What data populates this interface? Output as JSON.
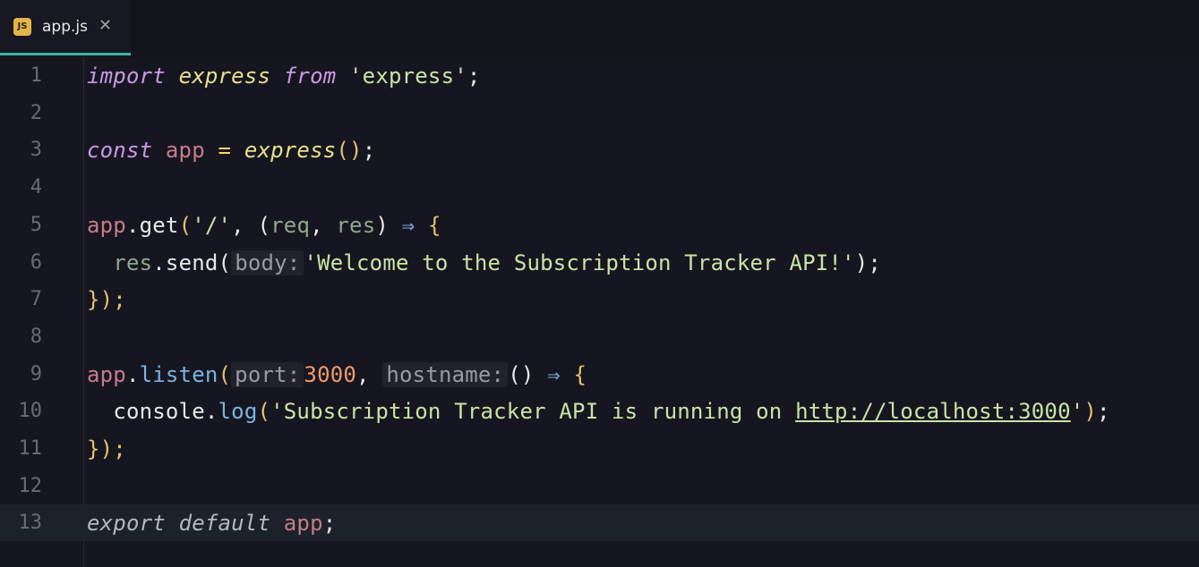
{
  "tab": {
    "icon": "JS",
    "label": "app.js",
    "close": "✕"
  },
  "lines": [
    {
      "n": "1"
    },
    {
      "n": "2"
    },
    {
      "n": "3"
    },
    {
      "n": "4"
    },
    {
      "n": "5"
    },
    {
      "n": "6"
    },
    {
      "n": "7"
    },
    {
      "n": "8"
    },
    {
      "n": "9"
    },
    {
      "n": "10"
    },
    {
      "n": "11"
    },
    {
      "n": "12"
    },
    {
      "n": "13"
    }
  ],
  "code": {
    "l1": {
      "kw_import": "import",
      "id_express": "express",
      "kw_from": "from",
      "str": "'express'",
      "semi": ";"
    },
    "l3": {
      "kw_const": "const",
      "var_app": "app",
      "eq": "=",
      "fn_express": "express",
      "paren": "()",
      "semi": ";"
    },
    "l5": {
      "var_app": "app",
      "dot": ".",
      "method": "get",
      "open": "(",
      "str": "'/'",
      "comma": ",",
      "open2": "(",
      "req": "req",
      "comma2": ",",
      "res": "res",
      "close2": ")",
      "arrow": "⇒",
      "brace": "{"
    },
    "l6": {
      "res": "res",
      "dot": ".",
      "method": "send",
      "open": "(",
      "hint": "body:",
      "str": "'Welcome to the Subscription Tracker API!'",
      "close": ")",
      "semi": ";"
    },
    "l7": {
      "text": "});"
    },
    "l9": {
      "var_app": "app",
      "dot": ".",
      "method": "listen",
      "open": "(",
      "hint_port": "port:",
      "num": "3000",
      "comma": ",",
      "hint_host": "hostname:",
      "parens": "()",
      "arrow": "⇒",
      "brace": "{"
    },
    "l10": {
      "console": "console",
      "dot": ".",
      "method": "log",
      "open": "(",
      "str_start": "'Subscription Tracker API is running on ",
      "url": "http://localhost:3000",
      "str_end": "'",
      "close": ")",
      "semi": ";"
    },
    "l11": {
      "text": "});"
    },
    "l13": {
      "kw_export": "export",
      "kw_default": "default",
      "var_app": "app",
      "semi": ";"
    }
  },
  "colors": {
    "background": "#161620",
    "tab_accent": "#3fb3a9",
    "js_icon": "#e3b549"
  }
}
